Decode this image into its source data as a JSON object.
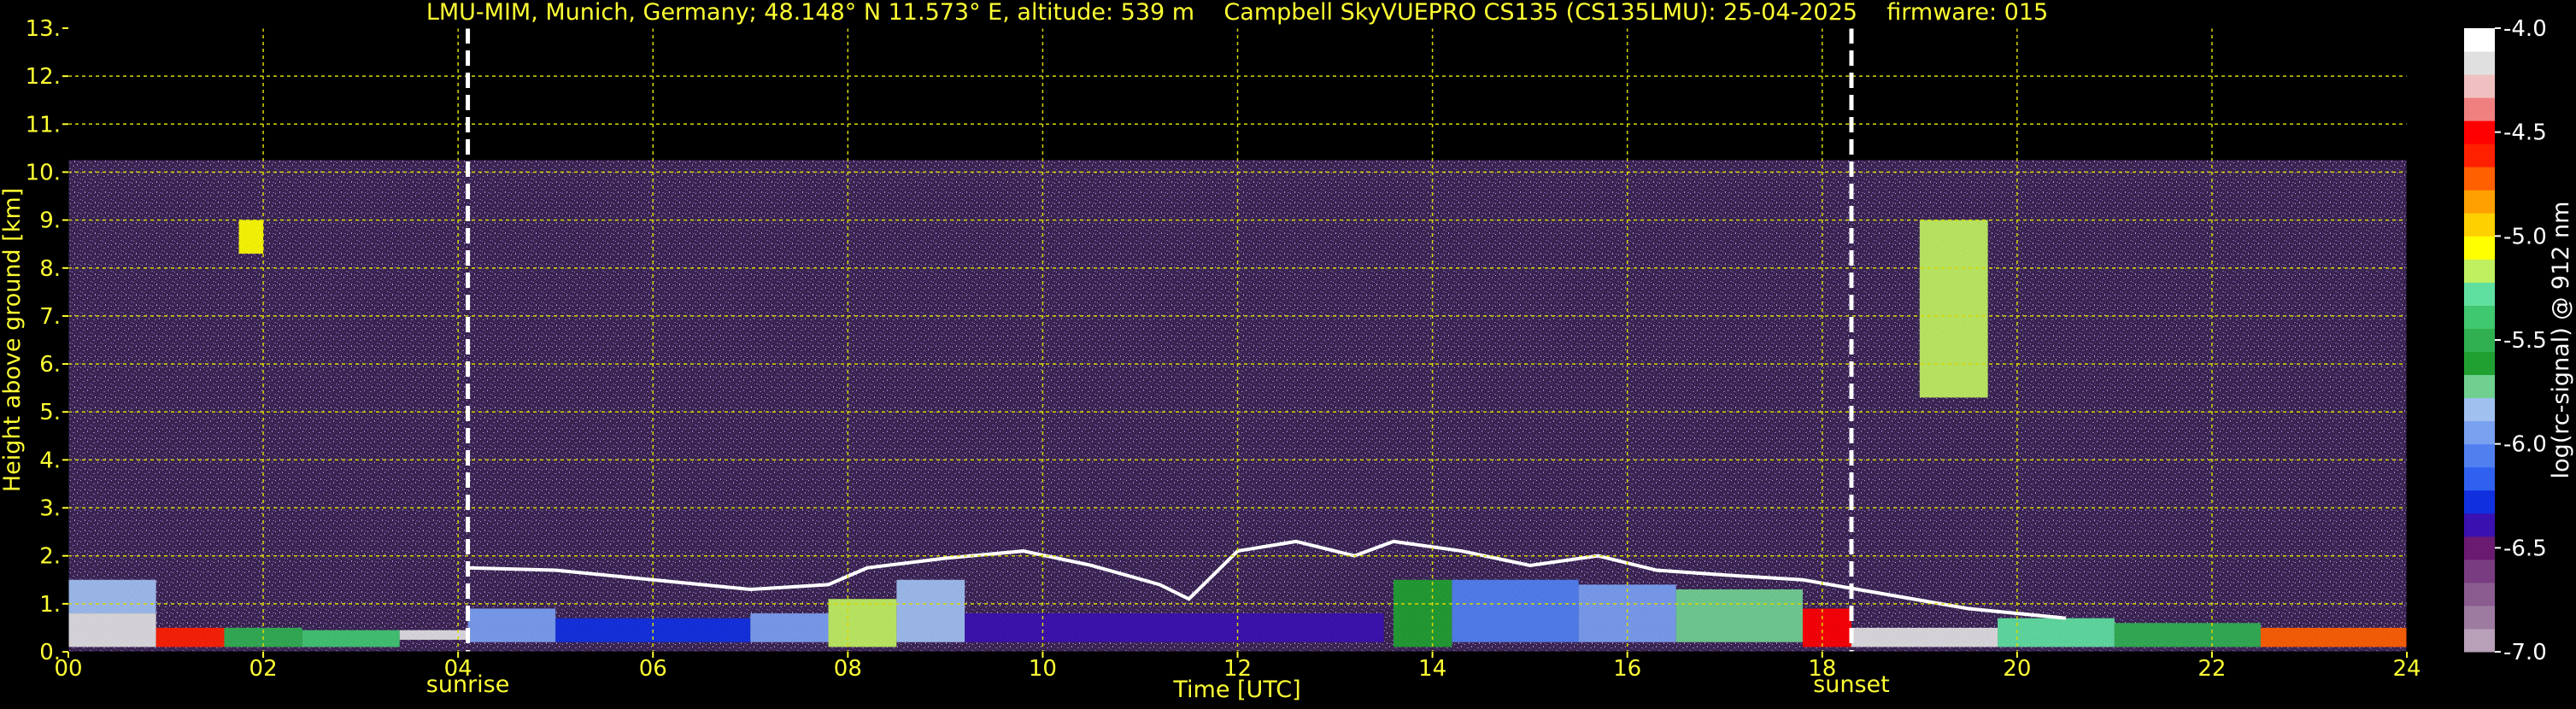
{
  "chart_data": {
    "type": "heatmap",
    "title": "LMU-MIM, Munich, Germany; 48.148° N 11.573° E, altitude: 539 m    Campbell SkyVUEPRO CS135 (CS135LMU): 25-04-2025    firmware: 015",
    "xlabel": "Time [UTC]",
    "ylabel": "Height above ground [km]",
    "xlim": [
      0,
      24
    ],
    "ylim": [
      0,
      13
    ],
    "x_ticks": [
      {
        "value": 0,
        "label": "00"
      },
      {
        "value": 2,
        "label": "02"
      },
      {
        "value": 4,
        "label": "04"
      },
      {
        "value": 6,
        "label": "06"
      },
      {
        "value": 8,
        "label": "08"
      },
      {
        "value": 10,
        "label": "10"
      },
      {
        "value": 12,
        "label": "12"
      },
      {
        "value": 14,
        "label": "14"
      },
      {
        "value": 16,
        "label": "16"
      },
      {
        "value": 18,
        "label": "18"
      },
      {
        "value": 20,
        "label": "20"
      },
      {
        "value": 22,
        "label": "22"
      },
      {
        "value": 24,
        "label": "24"
      }
    ],
    "y_ticks": [
      {
        "value": 0,
        "label": "0."
      },
      {
        "value": 1,
        "label": "1."
      },
      {
        "value": 2,
        "label": "2."
      },
      {
        "value": 3,
        "label": "3."
      },
      {
        "value": 4,
        "label": "4."
      },
      {
        "value": 5,
        "label": "5."
      },
      {
        "value": 6,
        "label": "6."
      },
      {
        "value": 7,
        "label": "7."
      },
      {
        "value": 8,
        "label": "8."
      },
      {
        "value": 9,
        "label": "9."
      },
      {
        "value": 10,
        "label": "10."
      },
      {
        "value": 11,
        "label": "11."
      },
      {
        "value": 12,
        "label": "12."
      },
      {
        "value": 13,
        "label": "13."
      }
    ],
    "grid": true,
    "events": [
      {
        "name": "sunrise",
        "time": 4.1
      },
      {
        "name": "sunset",
        "time": 18.3
      }
    ],
    "signal_top_km": 10.25,
    "layers": [
      {
        "t0": 0.0,
        "t1": 0.9,
        "h0": 0.1,
        "h1": 0.8,
        "level": -4.2
      },
      {
        "t0": 0.0,
        "t1": 0.9,
        "h0": 0.8,
        "h1": 1.5,
        "level": -5.8
      },
      {
        "t0": 0.9,
        "t1": 1.6,
        "h0": 0.1,
        "h1": 0.5,
        "level": -4.6
      },
      {
        "t0": 1.6,
        "t1": 2.4,
        "h0": 0.1,
        "h1": 0.5,
        "level": -5.5
      },
      {
        "t0": 1.75,
        "t1": 2.0,
        "h0": 8.3,
        "h1": 9.0,
        "level": -5.1
      },
      {
        "t0": 2.4,
        "t1": 3.4,
        "h0": 0.1,
        "h1": 0.45,
        "level": -5.4
      },
      {
        "t0": 3.4,
        "t1": 4.1,
        "h0": 0.25,
        "h1": 0.45,
        "level": -4.2
      },
      {
        "t0": 4.1,
        "t1": 5.0,
        "h0": 0.2,
        "h1": 0.9,
        "level": -6.0
      },
      {
        "t0": 5.0,
        "t1": 7.0,
        "h0": 0.2,
        "h1": 0.7,
        "level": -6.3
      },
      {
        "t0": 7.0,
        "t1": 7.8,
        "h0": 0.2,
        "h1": 0.8,
        "level": -6.0
      },
      {
        "t0": 7.8,
        "t1": 8.5,
        "h0": 0.1,
        "h1": 1.1,
        "level": -5.2
      },
      {
        "t0": 8.5,
        "t1": 9.2,
        "h0": 0.2,
        "h1": 1.5,
        "level": -5.8
      },
      {
        "t0": 9.2,
        "t1": 13.5,
        "h0": 0.2,
        "h1": 0.8,
        "level": -6.4
      },
      {
        "t0": 13.6,
        "t1": 14.2,
        "h0": 0.1,
        "h1": 1.5,
        "level": -5.6
      },
      {
        "t0": 14.2,
        "t1": 15.5,
        "h0": 0.2,
        "h1": 1.5,
        "level": -6.1
      },
      {
        "t0": 15.5,
        "t1": 16.5,
        "h0": 0.2,
        "h1": 1.4,
        "level": -6.0
      },
      {
        "t0": 16.5,
        "t1": 17.8,
        "h0": 0.2,
        "h1": 1.3,
        "level": -5.7
      },
      {
        "t0": 17.8,
        "t1": 18.3,
        "h0": 0.1,
        "h1": 0.9,
        "level": -4.5
      },
      {
        "t0": 18.3,
        "t1": 19.8,
        "h0": 0.1,
        "h1": 0.5,
        "level": -4.2
      },
      {
        "t0": 19.0,
        "t1": 19.7,
        "h0": 5.3,
        "h1": 9.0,
        "level": -5.2
      },
      {
        "t0": 19.8,
        "t1": 21.0,
        "h0": 0.1,
        "h1": 0.7,
        "level": -5.3
      },
      {
        "t0": 21.0,
        "t1": 22.5,
        "h0": 0.1,
        "h1": 0.6,
        "level": -5.5
      },
      {
        "t0": 22.5,
        "t1": 24.0,
        "h0": 0.1,
        "h1": 0.5,
        "level": -4.7
      }
    ],
    "cloud_base": [
      {
        "t": 4.1,
        "h": 1.75
      },
      {
        "t": 5.0,
        "h": 1.7
      },
      {
        "t": 6.0,
        "h": 1.5
      },
      {
        "t": 7.0,
        "h": 1.3
      },
      {
        "t": 7.8,
        "h": 1.4
      },
      {
        "t": 8.2,
        "h": 1.75
      },
      {
        "t": 9.0,
        "h": 1.95
      },
      {
        "t": 9.8,
        "h": 2.1
      },
      {
        "t": 10.5,
        "h": 1.8
      },
      {
        "t": 11.2,
        "h": 1.4
      },
      {
        "t": 11.5,
        "h": 1.1
      },
      {
        "t": 12.0,
        "h": 2.1
      },
      {
        "t": 12.6,
        "h": 2.3
      },
      {
        "t": 13.2,
        "h": 2.0
      },
      {
        "t": 13.6,
        "h": 2.3
      },
      {
        "t": 14.3,
        "h": 2.1
      },
      {
        "t": 15.0,
        "h": 1.8
      },
      {
        "t": 15.7,
        "h": 2.0
      },
      {
        "t": 16.3,
        "h": 1.7
      },
      {
        "t": 17.0,
        "h": 1.6
      },
      {
        "t": 17.8,
        "h": 1.5
      },
      {
        "t": 19.5,
        "h": 0.9
      },
      {
        "t": 20.5,
        "h": 0.7
      }
    ],
    "colorbar": {
      "label": "log(rc-signal) @ 912 nm",
      "min": -7.0,
      "max": -4.0,
      "tick_labels": [
        "-4.0",
        "-4.5",
        "-5.0",
        "-5.5",
        "-6.0",
        "-6.5",
        "-7.0"
      ],
      "tick_values": [
        -4.0,
        -4.5,
        -5.0,
        -5.5,
        -6.0,
        -6.5,
        -7.0
      ],
      "colors": [
        "#b8a0b8",
        "#9d7ba0",
        "#8a5c90",
        "#7a3c80",
        "#6a1a70",
        "#3a10b0",
        "#1030e0",
        "#3060f0",
        "#5080f0",
        "#7aa0f0",
        "#a0c0f0",
        "#70d090",
        "#20a030",
        "#30b050",
        "#40c870",
        "#60e0a0",
        "#c0f060",
        "#ffff00",
        "#ffd000",
        "#ffa000",
        "#ff6000",
        "#ff2000",
        "#ff0000",
        "#f08080",
        "#f0c0c0",
        "#e0e0e0",
        "#ffffff"
      ]
    }
  }
}
